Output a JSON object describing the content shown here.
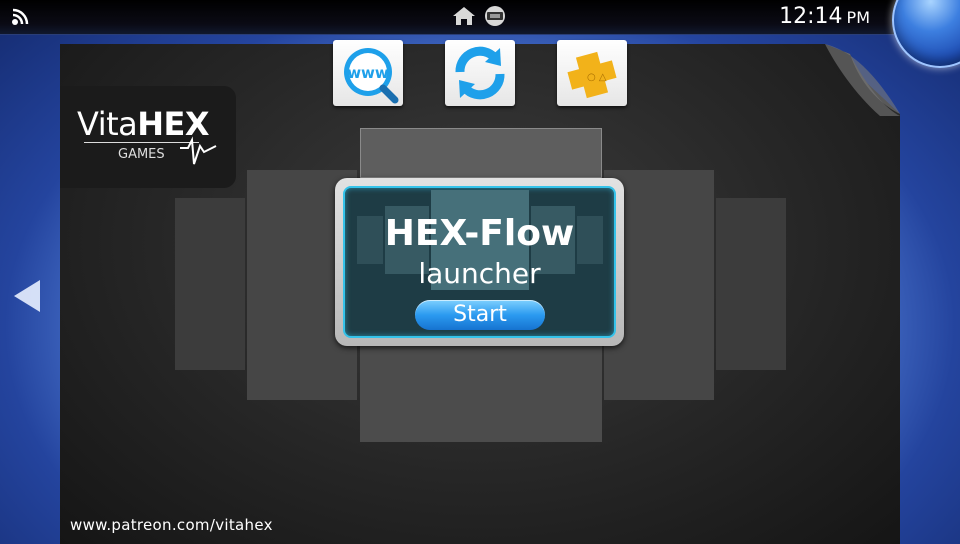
{
  "status_bar": {
    "time": "12:14",
    "ampm": "PM",
    "icons": [
      "wifi-icon",
      "home-icon",
      "cartridge-icon"
    ]
  },
  "top_apps": [
    {
      "name": "browser",
      "icon": "www-search-icon"
    },
    {
      "name": "refresh",
      "icon": "refresh-arrows-icon"
    },
    {
      "name": "playstation-plus",
      "icon": "ps-plus-icon"
    }
  ],
  "logo": {
    "text_regular": "Vita",
    "text_bold": "HEX",
    "sub": "GAMES"
  },
  "launcher": {
    "title": "HEX-Flow",
    "subtitle": "launcher",
    "start_label": "Start"
  },
  "footer": {
    "url": "www.patreon.com/vitahex"
  },
  "colors": {
    "accent": "#35c3ea",
    "button_blue": "#2b9af0",
    "background_blue": "#5f8fe8"
  }
}
